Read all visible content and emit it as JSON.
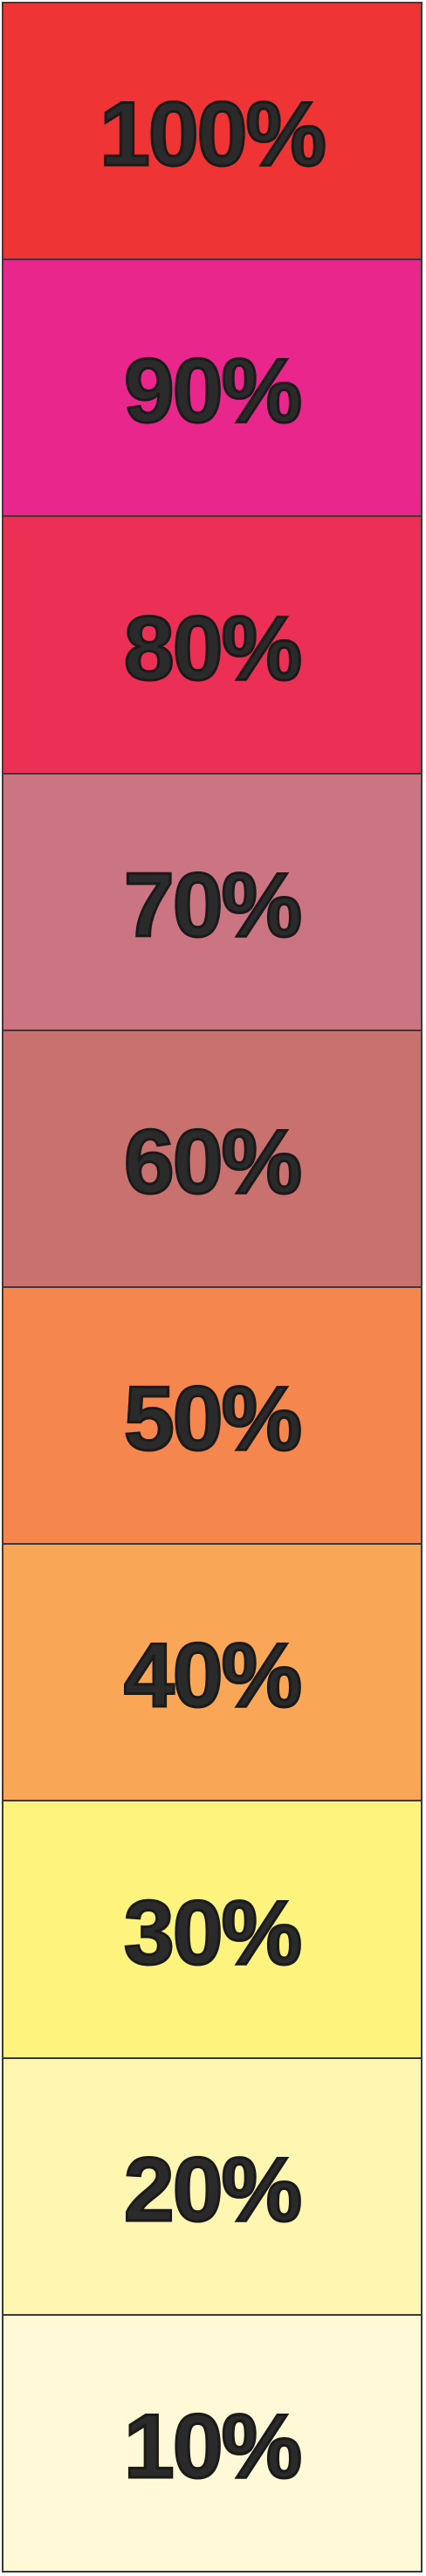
{
  "swatches": [
    {
      "label": "100%",
      "color": "#ee3434"
    },
    {
      "label": "90%",
      "color": "#e9268c"
    },
    {
      "label": "80%",
      "color": "#ec2f55"
    },
    {
      "label": "70%",
      "color": "#cb7482"
    },
    {
      "label": "60%",
      "color": "#c8716f"
    },
    {
      "label": "50%",
      "color": "#f5874e"
    },
    {
      "label": "40%",
      "color": "#f9a656"
    },
    {
      "label": "30%",
      "color": "#fef47d"
    },
    {
      "label": "20%",
      "color": "#fef6b1"
    },
    {
      "label": "10%",
      "color": "#fff9d7"
    }
  ]
}
